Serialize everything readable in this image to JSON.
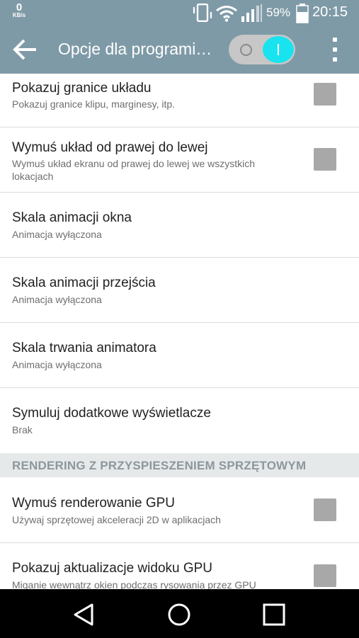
{
  "status_bar": {
    "speed_value": "0",
    "speed_unit": "KB/s",
    "icons": [
      "vibrate-icon",
      "wifi-icon",
      "signal-icon",
      "battery-icon"
    ],
    "battery": "59%",
    "time": "20:15"
  },
  "app_bar": {
    "title": "Opcje dla programi…",
    "back_icon": "arrow-back-icon",
    "toggle_on": true,
    "toggle_on_label": "I",
    "overflow_icon": "more-vert-icon",
    "background": "#7f9aa7",
    "toggle_accent": "#19e3ee"
  },
  "settings": [
    {
      "title": "Pokazuj granice układu",
      "summary": "Pokazuj granice klipu, marginesy, itp.",
      "checkbox": true,
      "checked": false
    },
    {
      "title": "Wymuś układ od prawej do lewej",
      "summary": "Wymuś układ ekranu od prawej do lewej we wszystkich lokacjach",
      "checkbox": true,
      "checked": false
    },
    {
      "title": "Skala animacji okna",
      "summary": "Animacja wyłączona",
      "checkbox": false
    },
    {
      "title": "Skala animacji przejścia",
      "summary": "Animacja wyłączona",
      "checkbox": false
    },
    {
      "title": "Skala trwania animatora",
      "summary": "Animacja wyłączona",
      "checkbox": false
    },
    {
      "title": "Symuluj dodatkowe wyświetlacze",
      "summary": "Brak",
      "checkbox": false
    }
  ],
  "section_header": "RENDERING Z PRZYSPIESZENIEM SPRZĘTOWYM",
  "gpu_settings": [
    {
      "title": "Wymuś renderowanie GPU",
      "summary": "Używaj sprzętowej akceleracji 2D w aplikacjach",
      "checkbox": true,
      "checked": false
    },
    {
      "title": "Pokazuj aktualizacje widoku GPU",
      "summary": "Miganie wewnątrz okien podczas rysowania przez GPU",
      "checkbox": true,
      "checked": false
    }
  ],
  "nav_bar": {
    "buttons": [
      "back-triangle-icon",
      "home-circle-icon",
      "recents-square-icon"
    ]
  }
}
